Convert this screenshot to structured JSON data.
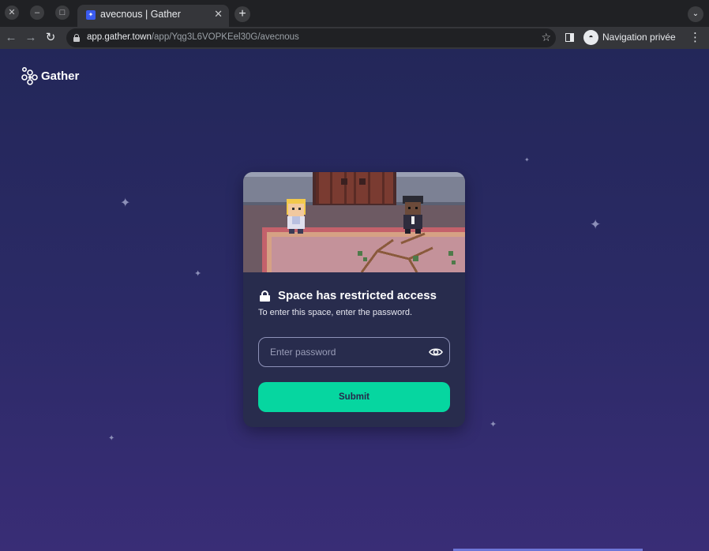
{
  "browser": {
    "window_controls": {
      "close": "✕",
      "minimize": "–",
      "maximize": "□"
    },
    "tab": {
      "title": "avecnous | Gather",
      "favicon": "gather-favicon"
    },
    "new_tab": "+",
    "url_host": "app.gather.town",
    "url_path": "/app/Yqg3L6VOPKEel30G/avecnous",
    "profile_label": "Navigation privée",
    "icons": [
      "back-arrow-icon",
      "forward-arrow-icon",
      "reload-icon",
      "lock-icon",
      "star-icon",
      "side-panel-icon",
      "incognito-icon",
      "menu-icon",
      "tab-search-icon"
    ]
  },
  "page": {
    "logo_text": "Gather",
    "card": {
      "title": "Space has restricted access",
      "subtitle": "To enter this space, enter the password.",
      "password_placeholder": "Enter password",
      "password_value": "",
      "submit_label": "Submit"
    }
  },
  "colors": {
    "accent": "#06d6a0",
    "card_bg": "#282c4d",
    "page_bg_top": "#232759",
    "page_bg_bottom": "#392d76"
  }
}
